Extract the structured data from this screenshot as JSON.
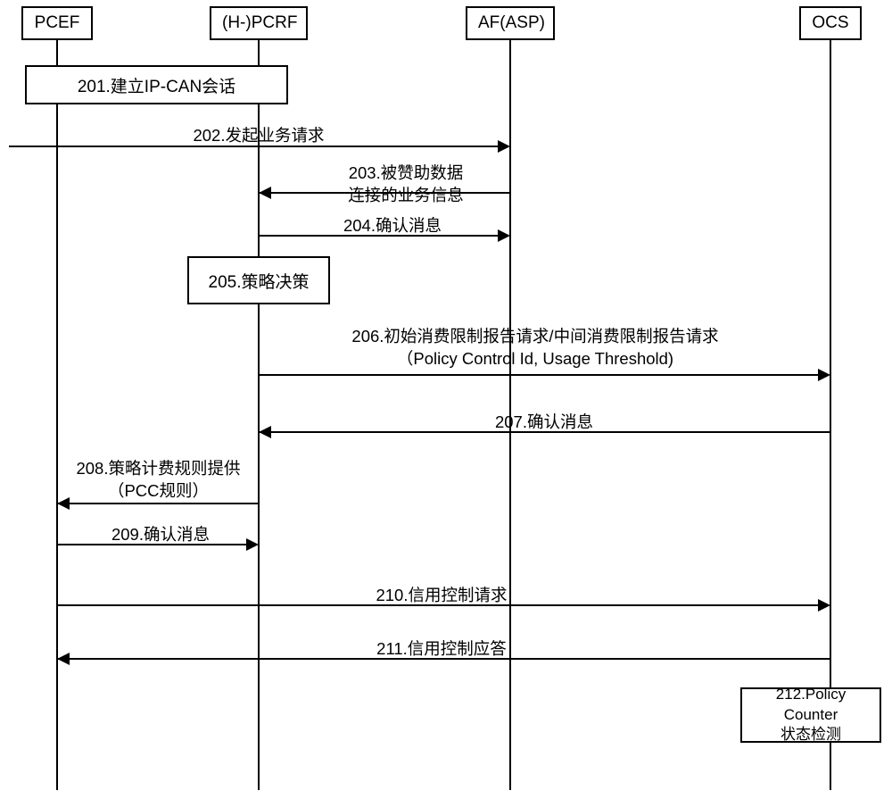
{
  "participants": {
    "pcef": "PCEF",
    "pcrf": "(H-)PCRF",
    "af": "AF(ASP)",
    "ocs": "OCS"
  },
  "steps": {
    "s201": "201.建立IP-CAN会话",
    "s202": "202.发起业务请求",
    "s203_l1": "203.被赞助数据",
    "s203_l2": "连接的业务信息",
    "s204": "204.确认消息",
    "s205": "205.策略决策",
    "s206_l1": "206.初始消费限制报告请求/中间消费限制报告请求",
    "s206_l2": "（Policy Control Id, Usage Threshold)",
    "s207": "207.确认消息",
    "s208_l1": "208.策略计费规则提供",
    "s208_l2": "（PCC规则）",
    "s209": "209.确认消息",
    "s210": "210.信用控制请求",
    "s211": "211.信用控制应答",
    "s212_l1": "212.Policy Counter",
    "s212_l2": "状态检测"
  }
}
